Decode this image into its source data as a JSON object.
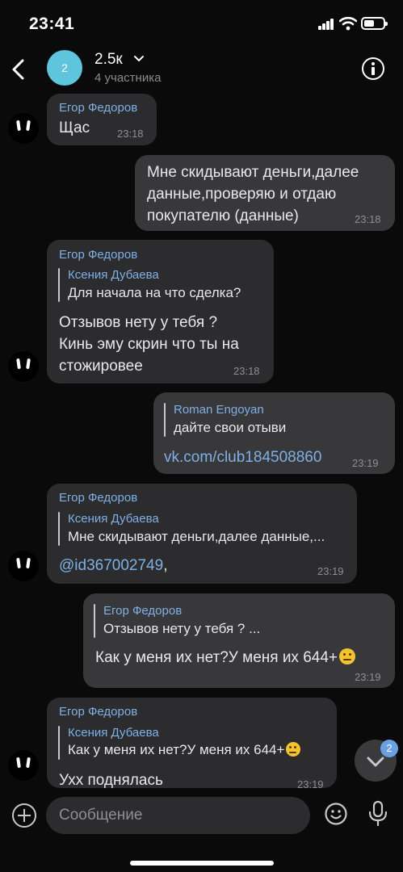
{
  "status_bar": {
    "time": "23:41"
  },
  "header": {
    "avatar_text": "2",
    "title": "2.5к",
    "subtitle": "4 участника"
  },
  "messages": [
    {
      "sender": "Егор Федоров",
      "text": "Щас",
      "time": "23:18"
    },
    {
      "text_lines": [
        "Мне скидывают деньги,далее",
        "данные,проверяю и отдаю",
        "покупателю (данные)"
      ],
      "time": "23:18"
    },
    {
      "sender": "Егор Федоров",
      "quote_author": "Ксения Дубаева",
      "quote_text": "Для начала на что сделка?",
      "text_lines": [
        "Отзывов нету у тебя ?",
        "Кинь эму скрин что ты на",
        "стожировее"
      ],
      "time": "23:18"
    },
    {
      "quote_author": "Roman Engoyan",
      "quote_text": "дайте свои отыви",
      "link": "vk.com/club184508860",
      "time": "23:19"
    },
    {
      "sender": "Егор Федоров",
      "quote_author": "Ксения Дубаева",
      "quote_text": "Мне скидывают деньги,далее данные,...",
      "mention": "@id367002749",
      "mention_suffix": ",",
      "time": "23:19"
    },
    {
      "quote_author": "Егор Федоров",
      "quote_text": "Отзывов нету у тебя ? ...",
      "text": "Как у меня их нет?У меня их 644+",
      "time": "23:19"
    },
    {
      "sender": "Егор Федоров",
      "quote_author": "Ксения Дубаева",
      "quote_text": "Как у меня их нет?У меня их 644+",
      "text": "Ухх поднялась",
      "time": "23:19"
    }
  ],
  "scroll_button": {
    "badge": "2"
  },
  "composer": {
    "placeholder": "Сообщение"
  },
  "icons": [
    "back-icon",
    "chevron-down-icon",
    "info-icon",
    "attach-icon",
    "emoji-icon",
    "microphone-icon",
    "chevron-down-icon"
  ],
  "colors": {
    "background": "#0a0a0a",
    "bubble": "#2c2c2e",
    "accent": "#7eb0e5",
    "avatar": "#5ec5dc"
  }
}
